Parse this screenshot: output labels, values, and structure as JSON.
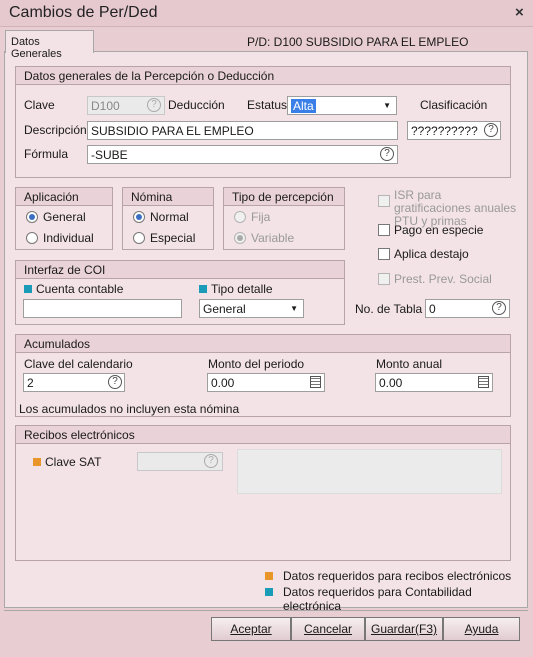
{
  "window": {
    "title": "Cambios de Per/Ded",
    "close_glyph": "×"
  },
  "tabs": [
    {
      "label": "Datos Generales"
    }
  ],
  "pd_label": "P/D: D100  SUBSIDIO PARA EL EMPLEO",
  "datos": {
    "header": "Datos generales de la Percepción o Deducción",
    "clave_label": "Clave",
    "clave_value": "D100",
    "tipo_label": "Deducción",
    "estatus_label": "Estatus",
    "estatus_value": "Alta",
    "clasificacion_label": "Clasificación",
    "descripcion_label": "Descripción",
    "descripcion_value": "SUBSIDIO PARA EL EMPLEO",
    "clasificacion_value": "??????????",
    "formula_label": "Fórmula",
    "formula_value": "-SUBE"
  },
  "aplicacion": {
    "header": "Aplicación",
    "general": "General",
    "individual": "Individual"
  },
  "nomina": {
    "header": "Nómina",
    "normal": "Normal",
    "especial": "Especial"
  },
  "tipo_percepcion": {
    "header": "Tipo de percepción",
    "fija": "Fija",
    "variable": "Variable"
  },
  "options": {
    "isr": "ISR para gratificaciones anuales PTU y primas",
    "pago_especie": "Pago en especie",
    "aplica_destajo": "Aplica destajo",
    "prest_prev": "Prest. Prev. Social"
  },
  "coi": {
    "header": "Interfaz de COI",
    "cuenta_label": "Cuenta contable",
    "cuenta_value": "",
    "tipo_detalle_label": "Tipo detalle",
    "tipo_detalle_value": "General"
  },
  "tabla": {
    "label": "No. de Tabla",
    "value": "0"
  },
  "acumulados": {
    "header": "Acumulados",
    "calendario_label": "Clave del calendario",
    "calendario_value": "2",
    "monto_periodo_label": "Monto del periodo",
    "monto_periodo_value": "0.00",
    "monto_anual_label": "Monto anual",
    "monto_anual_value": "0.00",
    "note": "Los acumulados no incluyen esta nómina"
  },
  "recibos": {
    "header": "Recibos electrónicos",
    "clave_sat_label": "Clave SAT",
    "clave_sat_value": ""
  },
  "legend": {
    "orange_text": "Datos requeridos para recibos electrónicos",
    "teal_text": "Datos requeridos para Contabilidad electrónica"
  },
  "buttons": {
    "aceptar": "Aceptar",
    "cancelar": "Cancelar",
    "guardar": "Guardar(F3)",
    "ayuda": "Ayuda"
  },
  "icons": {
    "help": "?"
  },
  "colors": {
    "orange": "#e8962a",
    "teal": "#1a9cb8",
    "selection": "#3a7ee8"
  }
}
